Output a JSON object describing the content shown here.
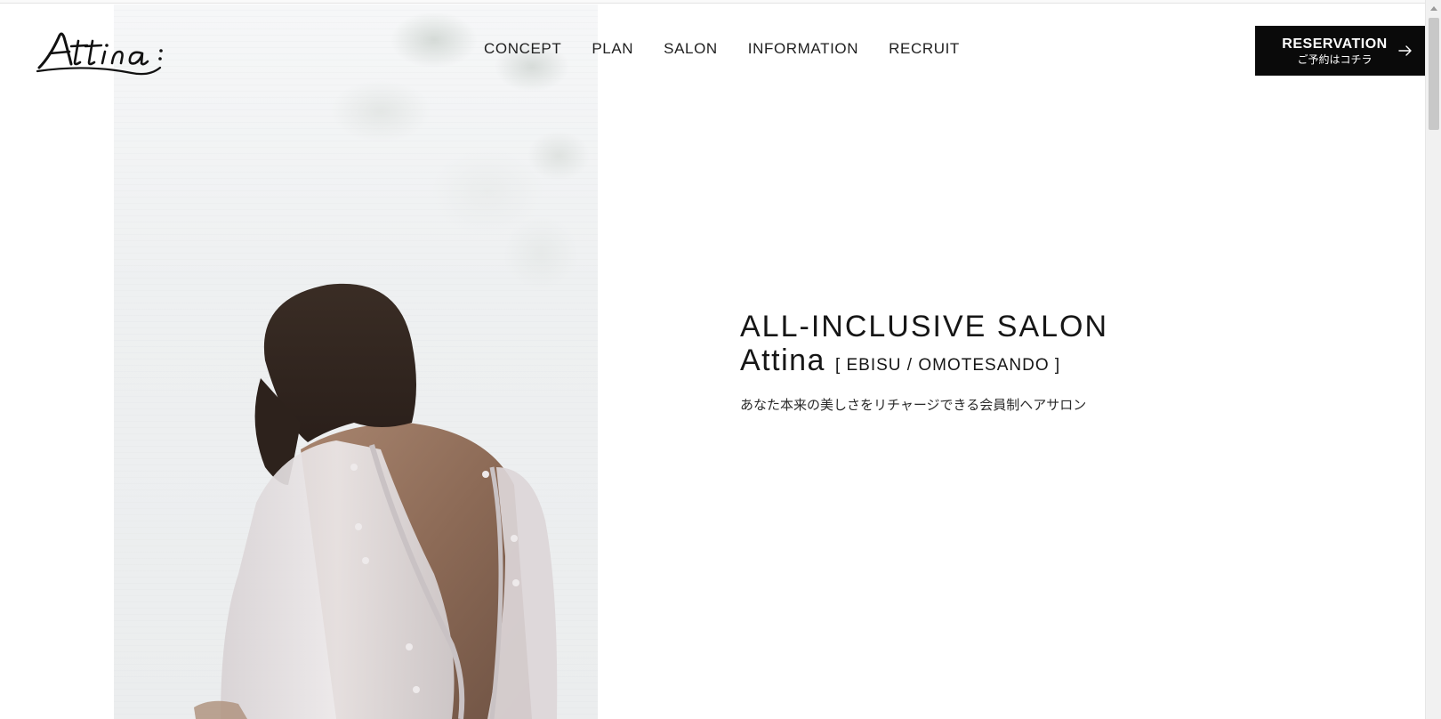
{
  "header": {
    "logo_text": "Attina",
    "nav": [
      {
        "label": "CONCEPT"
      },
      {
        "label": "PLAN"
      },
      {
        "label": "SALON"
      },
      {
        "label": "INFORMATION"
      },
      {
        "label": "RECRUIT"
      }
    ],
    "reservation": {
      "label": "RESERVATION",
      "sublabel": "ご予約はコチラ",
      "icon": "arrow-right-icon"
    }
  },
  "hero": {
    "title": "ALL-INCLUSIVE SALON",
    "brand": "Attina",
    "locations": "[ EBISU / OMOTESANDO ]",
    "tagline": "あなた本来の美しさをリチャージできる会員制ヘアサロン",
    "image": "woman-back-photo"
  },
  "colors": {
    "background": "#ffffff",
    "text": "#1a1a1a",
    "button": "#0a0a0a",
    "button_text": "#ffffff"
  }
}
